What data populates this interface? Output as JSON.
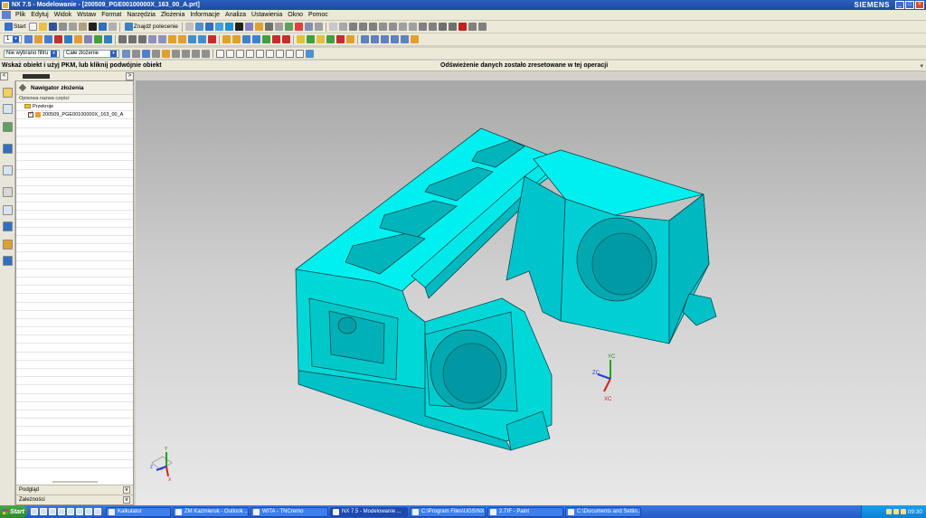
{
  "window": {
    "title": "NX 7.5 - Modelowanie - [200509_PGE00100000X_163_00_A.prt]",
    "brand": "SIEMENS"
  },
  "menu": [
    "Plik",
    "Edytuj",
    "Widok",
    "Wstaw",
    "Format",
    "Narzędzia",
    "Złożenia",
    "Informacje",
    "Analiza",
    "Ustawienia",
    "Okno",
    "Pomoc"
  ],
  "toolbar": {
    "start_label": "Start",
    "find_command_label": "Znajdź polecenie",
    "layer_value": "1"
  },
  "selection_bar": {
    "filter_value": "Nie wybrano filtru",
    "scope_value": "Całe złożenie"
  },
  "cue": {
    "prompt": "Wskaż obiekt i użyj PKM, lub kliknij podwójnie obiekt",
    "status": "Odświeżenie danych zostało zresetowane w tej operacji"
  },
  "navigator": {
    "title": "Nawigator złożenia",
    "column_header": "Opisowa nazwa części",
    "rows": [
      {
        "label": "Przekroje",
        "kind": "folder"
      },
      {
        "label": "200509_PGE00100000X_163_00_A",
        "kind": "part"
      }
    ],
    "bottom_panels": [
      "Podgląd",
      "Zależności"
    ]
  },
  "triad": {
    "main": {
      "y": "YC",
      "z": "ZC",
      "x": "XC"
    },
    "corner": {
      "y": "Y",
      "z": "Z",
      "x": "X"
    }
  },
  "colors": {
    "part_face": "#00e5e5",
    "part_dark": "#009fa8",
    "part_edge": "#004a50"
  },
  "taskbar": {
    "start": "Start",
    "tasks": [
      {
        "label": "Kalkulator",
        "active": false
      },
      {
        "label": "ZM Kazmieruk - Outlook ...",
        "active": false
      },
      {
        "label": "WtTA - TNCremo",
        "active": false
      },
      {
        "label": "NX 7.5 - Modelowanie ...",
        "active": true
      },
      {
        "label": "C:\\Program Files\\UGS\\NX...",
        "active": false
      },
      {
        "label": "2.TIF - Paint",
        "active": false
      },
      {
        "label": "C:\\Documents and Settin...",
        "active": false
      }
    ],
    "clock": "09:30"
  }
}
